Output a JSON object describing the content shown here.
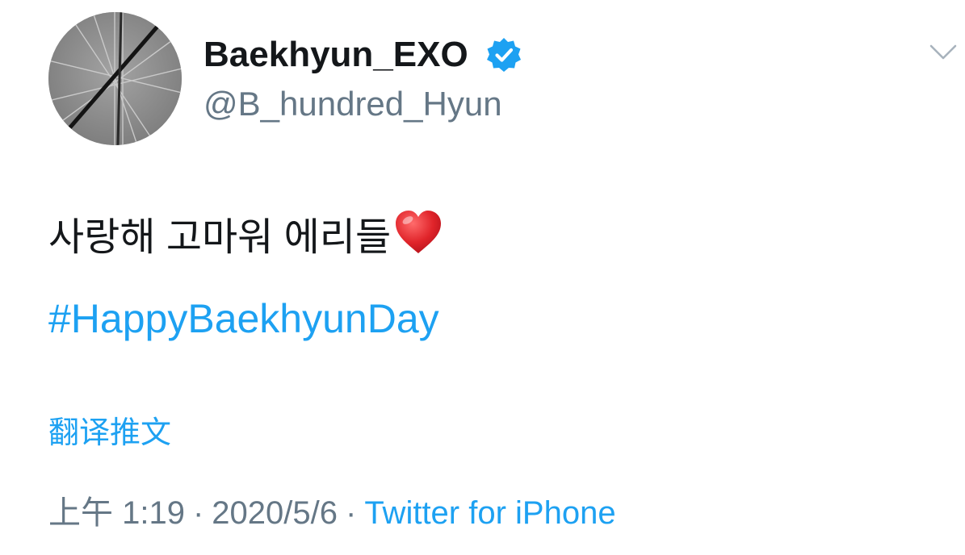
{
  "user": {
    "display_name": "Baekhyun_EXO",
    "handle": "@B_hundred_Hyun",
    "verified": true
  },
  "tweet": {
    "text": "사랑해 고마워 에리들",
    "emoji": "heart-emoji",
    "hashtag": "#HappyBaekhyunDay",
    "translate_label": "翻译推文"
  },
  "meta": {
    "time": "上午 1:19",
    "separator": "·",
    "date": "2020/5/6",
    "source": "Twitter for iPhone"
  },
  "icons": {
    "verified": "verified-badge-icon",
    "menu": "chevron-down-icon"
  },
  "colors": {
    "accent": "#1da1f2",
    "text": "#14171a",
    "secondary": "#657786",
    "heart": "#e0242a"
  }
}
